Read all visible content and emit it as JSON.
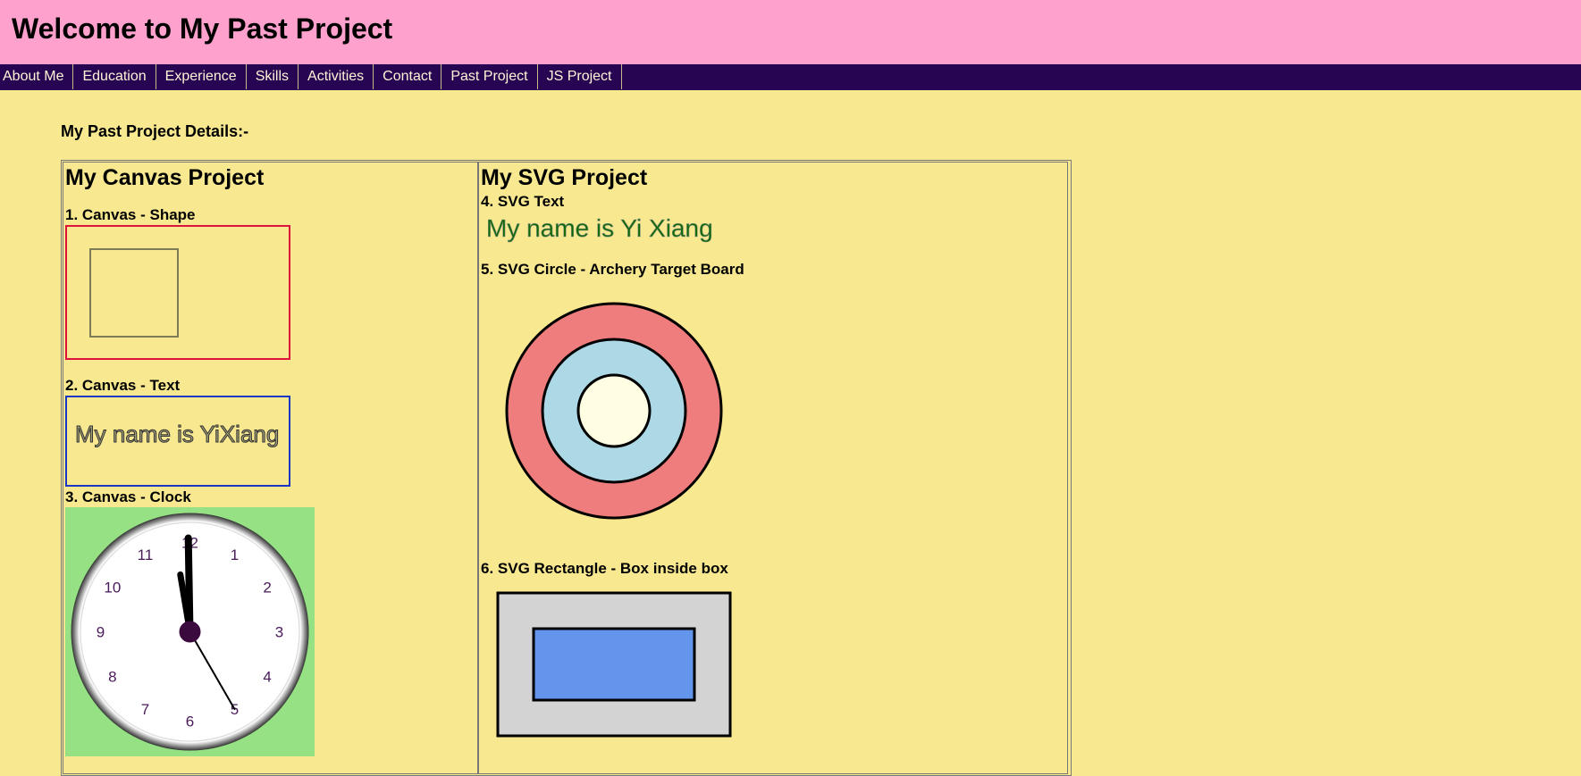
{
  "header": {
    "title": "Welcome to My Past Project"
  },
  "nav": {
    "items": [
      "About Me",
      "Education",
      "Experience",
      "Skills",
      "Activities",
      "Contact",
      "Past Project",
      "JS Project"
    ]
  },
  "main": {
    "heading": "My Past Project Details:-",
    "canvas": {
      "title": "My Canvas Project",
      "shape_label": "1. Canvas - Shape",
      "text_label": "2. Canvas - Text",
      "text_value": "My name is YiXiang",
      "clock_label": "3. Canvas - Clock",
      "clock_numbers": [
        "12",
        "1",
        "2",
        "3",
        "4",
        "5",
        "6",
        "7",
        "8",
        "9",
        "10",
        "11"
      ],
      "clock_time": "11:58:25"
    },
    "svg": {
      "title": "My SVG Project",
      "text_label": "4. SVG Text",
      "text_value": "My name is Yi Xiang",
      "circle_label": "5. SVG Circle - Archery Target Board",
      "rect_label": "6. SVG Rectangle - Box inside box"
    }
  },
  "colors": {
    "page_bg": "#f8e991",
    "header_bg": "#fea1cc",
    "nav_bg": "#280553",
    "clock_bg": "#95e184",
    "target_outer": "#f07d7d",
    "target_middle": "#add8e6",
    "target_inner": "#fffee2",
    "rect_outer": "#d3d3d3",
    "rect_inner": "#6495ed",
    "svg_text": "#0c6b00"
  }
}
